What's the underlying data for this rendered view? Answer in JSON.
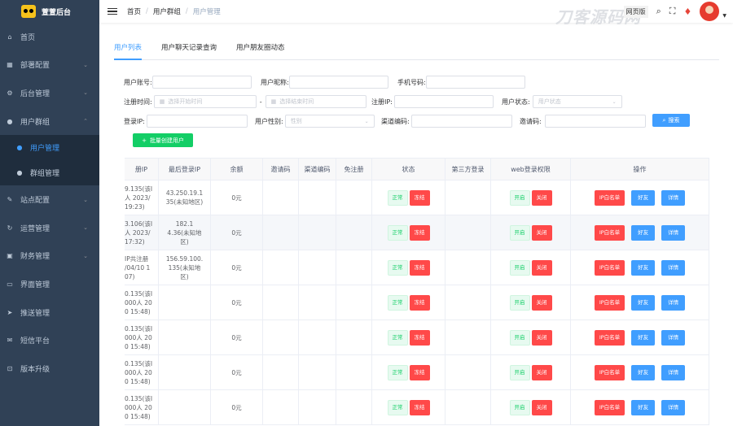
{
  "brand": {
    "title": "萱萱后台"
  },
  "sidebar": {
    "items": [
      {
        "label": "首页",
        "icon": "home-icon",
        "glyph": "⌂",
        "chevron": false
      },
      {
        "label": "部署配置",
        "icon": "grid-icon",
        "glyph": "▦",
        "chevron": true
      },
      {
        "label": "后台管理",
        "icon": "gear-icon",
        "glyph": "⚙",
        "chevron": true
      },
      {
        "label": "用户群组",
        "icon": "user-icon",
        "glyph": "●",
        "chevron": true,
        "expanded": true
      },
      {
        "label": "站点配置",
        "icon": "wrench-icon",
        "glyph": "✎",
        "chevron": true
      },
      {
        "label": "运营管理",
        "icon": "refresh-icon",
        "glyph": "↻",
        "chevron": true
      },
      {
        "label": "财务管理",
        "icon": "wallet-icon",
        "glyph": "▣",
        "chevron": true
      },
      {
        "label": "界面管理",
        "icon": "window-icon",
        "glyph": "▭",
        "chevron": false
      },
      {
        "label": "推送管理",
        "icon": "send-icon",
        "glyph": "➤",
        "chevron": false
      },
      {
        "label": "短信平台",
        "icon": "message-icon",
        "glyph": "✉",
        "chevron": false
      },
      {
        "label": "版本升级",
        "icon": "upgrade-icon",
        "glyph": "⊡",
        "chevron": false
      }
    ],
    "subitems": [
      {
        "label": "用户管理",
        "icon": "person-icon",
        "glyph": "●",
        "active": true
      },
      {
        "label": "群组管理",
        "icon": "group-icon",
        "glyph": "●",
        "active": false
      }
    ]
  },
  "topbar": {
    "breadcrumb": [
      "首页",
      "用户群组",
      "用户管理"
    ],
    "version_switch": "网页版",
    "watermark": "刀客源码网"
  },
  "tabs": [
    "用户列表",
    "用户聊天记录查询",
    "用户朋友圈动态"
  ],
  "filters": {
    "account_label": "用户账号:",
    "nickname_label": "用户昵称:",
    "phone_label": "手机号码:",
    "regtime_label": "注册时间:",
    "start_placeholder": "选择开始时间",
    "end_placeholder": "选择结束时间",
    "regip_label": "注册IP:",
    "status_label": "用户状态:",
    "status_placeholder": "用户状态",
    "loginip_label": "登录IP:",
    "gender_label": "用户性别:",
    "gender_placeholder": "性别",
    "channel_label": "渠道编码:",
    "invite_label": "邀请码:",
    "search_button": "搜索",
    "batch_button": "批量创建用户"
  },
  "table": {
    "headers": [
      "册IP",
      "最后登录IP",
      "余额",
      "邀请码",
      "渠道编码",
      "免注册",
      "状态",
      "第三方登录",
      "web登录权限",
      "操作"
    ],
    "rows": [
      {
        "reg_ip": "9.135(该I\n人 2023/\n19:23)",
        "last_ip": "43.250.19.1\n35(未知地区)",
        "balance": "0元"
      },
      {
        "reg_ip": "3.106(该I\n人 2023/\n17:32)",
        "last_ip": "182.1\n4.36(未知地\n区)",
        "balance": "0元"
      },
      {
        "reg_ip": "IP共注册\n/04/10 1\n07)",
        "last_ip": "156.59.100.\n135(未知地\n区)",
        "balance": "0元"
      },
      {
        "reg_ip": "0.135(该I\n000人 20\n0 15:48)",
        "last_ip": "",
        "balance": "0元"
      },
      {
        "reg_ip": "0.135(该I\n000人 20\n0 15:48)",
        "last_ip": "",
        "balance": "0元"
      },
      {
        "reg_ip": "0.135(该I\n000人 20\n0 15:48)",
        "last_ip": "",
        "balance": "0元"
      },
      {
        "reg_ip": "0.135(该I\n000人 20\n0 15:48)",
        "last_ip": "",
        "balance": "0元"
      }
    ],
    "status_tag": "正常",
    "freeze_button": "冻结",
    "web_on": "开启",
    "web_off": "关闭",
    "whitelist_button": "IP白名单",
    "friend_button": "好友",
    "detail_button": "详情"
  },
  "colors": {
    "sidebar_bg": "#304156",
    "accent": "#409eff",
    "danger": "#ff4949",
    "success": "#13ce66"
  }
}
